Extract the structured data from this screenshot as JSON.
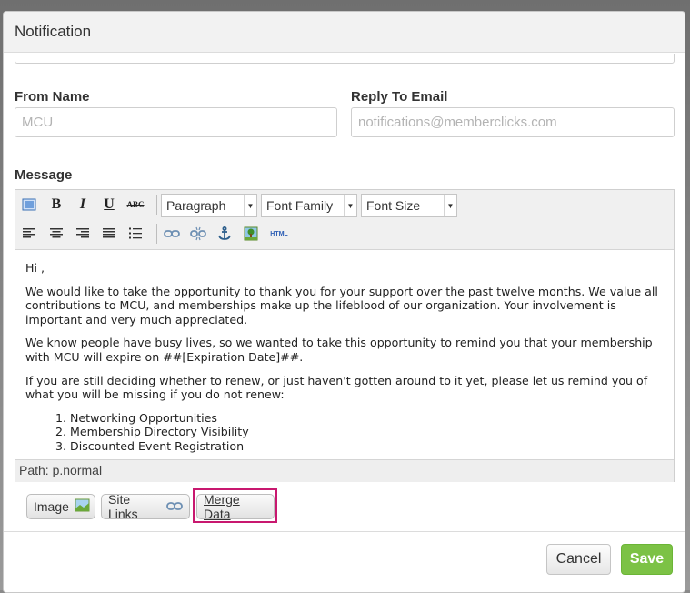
{
  "modal": {
    "title": "Notification"
  },
  "form": {
    "from_name_label": "From Name",
    "from_name_placeholder": "MCU",
    "reply_to_label": "Reply To Email",
    "reply_to_placeholder": "notifications@memberclicks.com",
    "message_label": "Message"
  },
  "toolbar": {
    "format_select": "Paragraph",
    "font_family_select": "Font Family",
    "font_size_select": "Font Size",
    "bold": "B",
    "italic": "I",
    "underline": "U",
    "strikethrough": "ABC",
    "html_button": "HTML"
  },
  "editor": {
    "greeting": "Hi ,",
    "paragraph1": "We would like to take the opportunity to thank you for your support over the past twelve months. We value all contributions to MCU, and memberships make up the lifeblood of our organization. Your involvement is important and very much appreciated.",
    "paragraph2": "We know people have busy lives, so we wanted to take this opportunity to remind you that your membership with MCU will expire on ##[Expiration Date]##.",
    "paragraph3": "If you are still deciding whether to renew, or just haven't gotten around to it yet, please let us remind you of what you will be missing if you do not renew:",
    "list": [
      "Networking Opportunities",
      "Membership Directory Visibility",
      "Discounted Event Registration"
    ],
    "path": "Path: p.normal"
  },
  "insert_buttons": {
    "image": "Image",
    "site_links": "Site Links",
    "merge_data": "Merge Data"
  },
  "footer": {
    "cancel": "Cancel",
    "save": "Save"
  },
  "colors": {
    "save_green": "#7cc245",
    "highlight": "#c8186f"
  }
}
